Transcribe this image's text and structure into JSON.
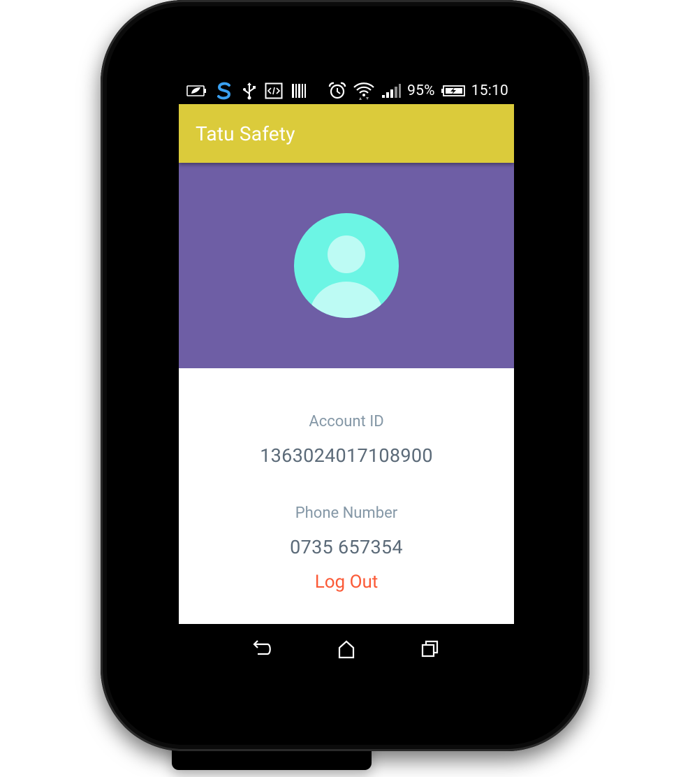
{
  "status_bar": {
    "battery_percent": "95%",
    "time": "15:10",
    "icons": [
      "battery-leaf-icon",
      "s-app-icon",
      "usb-icon",
      "code-icon",
      "barcode-icon",
      "alarm-icon",
      "wifi-icon",
      "signal-icon",
      "battery-charging-icon"
    ]
  },
  "app_bar": {
    "title": "Tatu Safety"
  },
  "profile": {
    "avatar_icon": "person-icon",
    "account_id_label": "Account ID",
    "account_id_value": "1363024017108900",
    "phone_label": "Phone Number",
    "phone_value": "0735 657354",
    "logout_label": "Log Out"
  },
  "colors": {
    "app_bar": "#dbcb3b",
    "header": "#6e5ea5",
    "avatar": "#6cf5e4",
    "label": "#8497a6",
    "value": "#5b6a78",
    "logout": "#fb5a37"
  },
  "nav_bar": {
    "icons": [
      "back-icon",
      "home-icon",
      "recents-icon"
    ]
  }
}
